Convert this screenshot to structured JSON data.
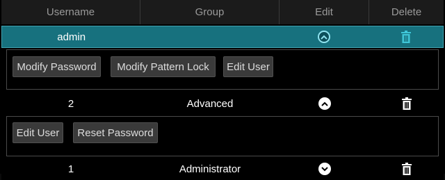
{
  "columns": {
    "username": "Username",
    "group": "Group",
    "edit": "Edit",
    "delete": "Delete"
  },
  "users": [
    {
      "username": "admin",
      "group": "",
      "expanded": true,
      "actions": [
        "Modify Password",
        "Modify Pattern Lock",
        "Edit User"
      ]
    },
    {
      "username": "2",
      "group": "Advanced",
      "expanded": true,
      "actions": [
        "Edit User",
        "Reset Password"
      ]
    },
    {
      "username": "1",
      "group": "Administrator",
      "expanded": false,
      "actions": []
    }
  ],
  "colors": {
    "selected_row": "#17717e",
    "accent_icon": "#3fc6d8",
    "header_bg": "#1b1b1b"
  },
  "icons": {
    "collapse": "chevron-up-icon",
    "expand": "chevron-down-icon",
    "delete": "trash-icon"
  }
}
